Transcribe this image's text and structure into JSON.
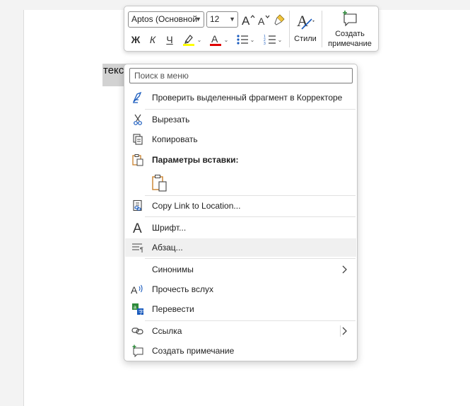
{
  "document": {
    "selected_text": "текст"
  },
  "mini_toolbar": {
    "font_name": "Aptos (Основной",
    "font_size": "12",
    "bold": "Ж",
    "italic": "К",
    "underline": "Ч",
    "styles_label": "Стили",
    "comment_label_line1": "Создать",
    "comment_label_line2": "примечание",
    "highlight_color": "#ffff00",
    "font_color": "#e00000"
  },
  "context_menu": {
    "search_placeholder": "Поиск в меню",
    "items": {
      "check_editor": "Проверить выделенный фрагмент в Корректоре",
      "cut": "Вырезать",
      "copy": "Копировать",
      "paste_options": "Параметры вставки:",
      "copy_link": "Copy Link to Location...",
      "font": "Шрифт...",
      "paragraph": "Абзац...",
      "synonyms": "Синонимы",
      "read_aloud": "Прочесть вслух",
      "translate": "Перевести",
      "link": "Ссылка",
      "new_comment": "Создать примечание"
    }
  },
  "colors": {
    "accent_blue": "#185abd",
    "paste_orange": "#c9802a",
    "translate_green": "#2d8a3a"
  }
}
